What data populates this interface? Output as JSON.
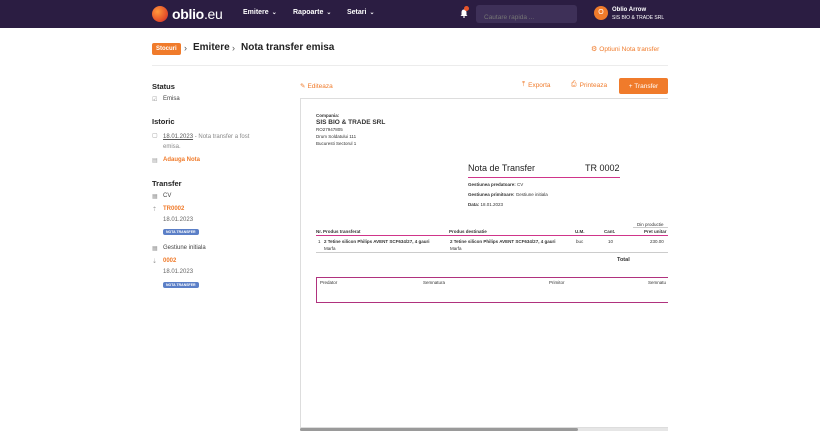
{
  "nav": {
    "logo_main": "oblio",
    "logo_tld": ".eu",
    "items": [
      {
        "label": "Emitere"
      },
      {
        "label": "Rapoarte"
      },
      {
        "label": "Setari"
      }
    ],
    "search_placeholder": "Cautare rapida ...",
    "user_initial": "O",
    "user_name": "Oblio Arrow",
    "user_company": "SIS BIO & TRADE SRL"
  },
  "breadcrumb": {
    "tag": "Stocuri",
    "level1": "Emitere",
    "level2": "Nota transfer emisa",
    "options_label": "Optiuni Nota transfer"
  },
  "sidebar": {
    "status_heading": "Status",
    "status_value": "Emisa",
    "istoric_heading": "Istoric",
    "istoric_date": "18.01.2023",
    "istoric_text1": " - Nota transfer a fost",
    "istoric_text2": "emisa.",
    "add_note": "Adauga Nota",
    "transfer_heading": "Transfer",
    "transfer_items": [
      {
        "gestiune": "CV",
        "doc_no": "TR0002",
        "date": "18.01.2023",
        "badge": "NOTA TRANSFER"
      },
      {
        "gestiune": "Gestiune initiala",
        "doc_no": "0002",
        "date": "18.01.2023",
        "badge": "NOTA TRANSFER"
      }
    ]
  },
  "toolbar": {
    "edit": "Editeaza",
    "export": "Exporta",
    "print": "Printeaza",
    "transfer": "+ Transfer"
  },
  "document": {
    "company_label": "Compania:",
    "company_name": "SIS BIO & TRADE SRL",
    "company_code": "RO27947805",
    "address1": "Drum Soldatului 111",
    "address2": "Bucuresti Sectorul 1",
    "title": "Nota de Transfer",
    "number": "TR 0002",
    "predatoare_label": "Gestiunea predatoare:",
    "predatoare_value": "CV",
    "primitoare_label": "Gestiunea primitoare:",
    "primitoare_value": "Gestiune initiala",
    "data_label": "Data:",
    "data_value": "18.01.2023",
    "table_group": "Din productie",
    "headers": [
      "Nr.",
      "Produs transferat",
      "Produs destinatie",
      "U.M.",
      "Cant.",
      "Pret unitar"
    ],
    "row": {
      "nr": "1",
      "produs_transferat": "2 Tetine silicon Philips AVENT SCF634/27, 4 gauri",
      "tip1": "Marfa",
      "produs_destinatie": "2 Tetine silicon Philips AVENT SCF634/27, 4 gauri",
      "tip2": "Marfa",
      "um": "buc",
      "cant": "10",
      "pret": "230.00"
    },
    "total_label": "Total",
    "sig_predator": "Predator",
    "sig_semnatura1": "Semnatura",
    "sig_primitor": "Primitor",
    "sig_semnatura2": "Semnatu"
  },
  "colors": {
    "nav_bg": "#2b1d42",
    "accent": "#f07b2b",
    "badge": "#5b7fc7",
    "doc_line": "#d0358a"
  }
}
